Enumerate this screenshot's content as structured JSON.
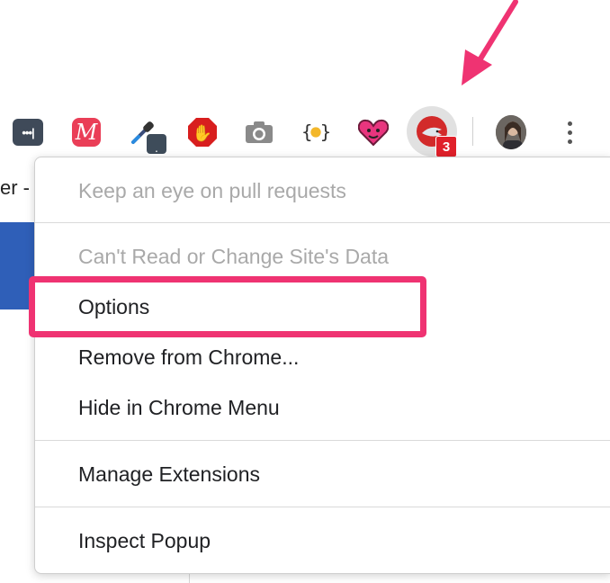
{
  "background": {
    "tab_text": "er -"
  },
  "toolbar": {
    "extensions": [
      {
        "name": "lastpass",
        "glyph": "•••|"
      },
      {
        "name": "mm",
        "glyph": "M"
      },
      {
        "name": "eyedropper",
        "badge": "."
      },
      {
        "name": "adblock",
        "glyph": "✋"
      },
      {
        "name": "camera"
      },
      {
        "name": "json",
        "glyph": "{•}"
      },
      {
        "name": "heart-cat"
      }
    ],
    "active_extension": {
      "badge_count": "3"
    }
  },
  "menu": {
    "items": [
      {
        "label": "Keep an eye on pull requests",
        "enabled": false
      },
      {
        "label": "Can't Read or Change Site's Data",
        "enabled": false
      },
      {
        "label": "Options",
        "enabled": true
      },
      {
        "label": "Remove from Chrome...",
        "enabled": true
      },
      {
        "label": "Hide in Chrome Menu",
        "enabled": true
      },
      {
        "label": "Manage Extensions",
        "enabled": true
      },
      {
        "label": "Inspect Popup",
        "enabled": true
      }
    ]
  },
  "colors": {
    "highlight": "#ef3372",
    "arrow": "#ef3372",
    "badge": "#e0202a"
  }
}
